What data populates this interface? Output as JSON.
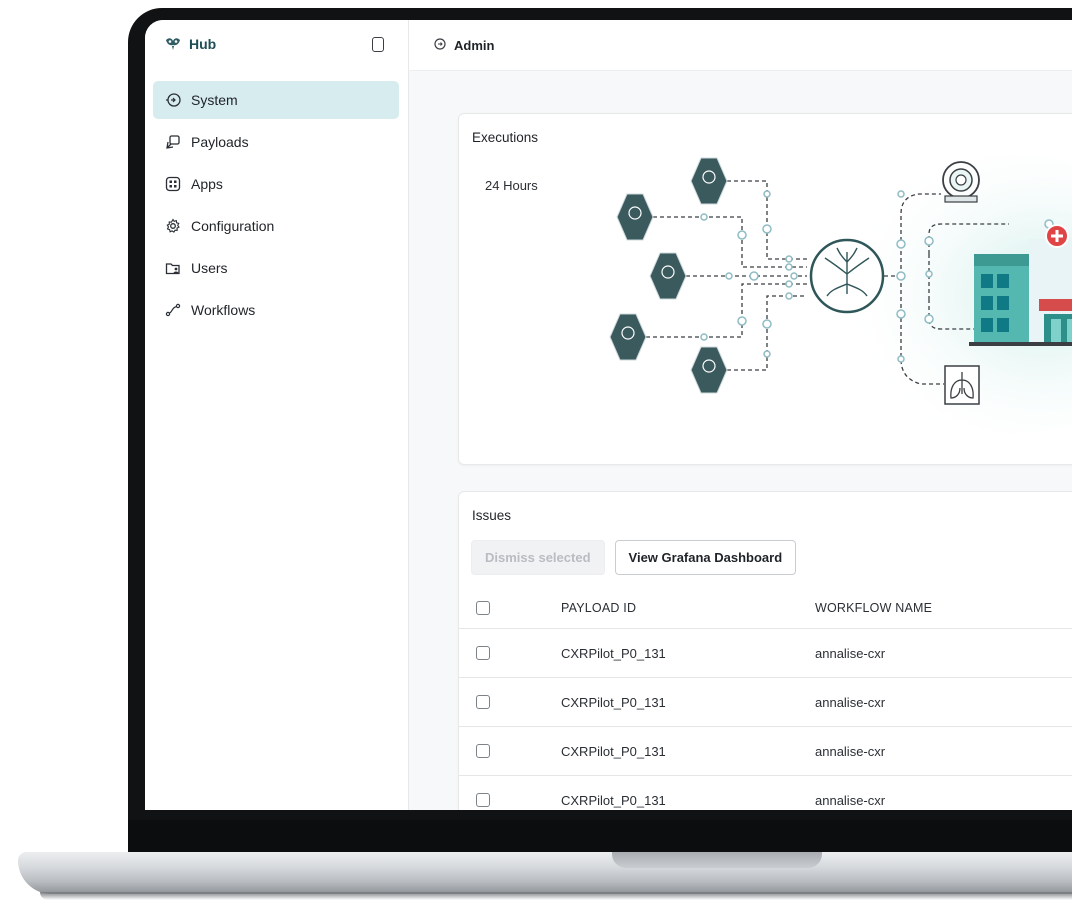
{
  "sidebar": {
    "brand": "Hub",
    "items": [
      {
        "label": "System",
        "icon": "system-icon",
        "active": true
      },
      {
        "label": "Payloads",
        "icon": "payloads-icon",
        "active": false
      },
      {
        "label": "Apps",
        "icon": "apps-icon",
        "active": false
      },
      {
        "label": "Configuration",
        "icon": "gear-icon",
        "active": false
      },
      {
        "label": "Users",
        "icon": "users-icon",
        "active": false
      },
      {
        "label": "Workflows",
        "icon": "workflows-icon",
        "active": false
      }
    ]
  },
  "header": {
    "title": "Admin"
  },
  "executions": {
    "title": "Executions",
    "range": "24 Hours"
  },
  "issues": {
    "title": "Issues",
    "dismiss_label": "Dismiss selected",
    "grafana_label": "View Grafana Dashboard",
    "columns": [
      "PAYLOAD ID",
      "WORKFLOW NAME"
    ],
    "rows": [
      {
        "payload_id": "CXRPilot_P0_131",
        "workflow": "annalise-cxr"
      },
      {
        "payload_id": "CXRPilot_P0_131",
        "workflow": "annalise-cxr"
      },
      {
        "payload_id": "CXRPilot_P0_131",
        "workflow": "annalise-cxr"
      },
      {
        "payload_id": "CXRPilot_P0_131",
        "workflow": "annalise-cxr"
      }
    ]
  },
  "colors": {
    "accent": "#1e4e56",
    "active_nav_bg": "#d7ecef",
    "node_fill": "#3a5a5e",
    "connector": "#8fbcc4"
  }
}
